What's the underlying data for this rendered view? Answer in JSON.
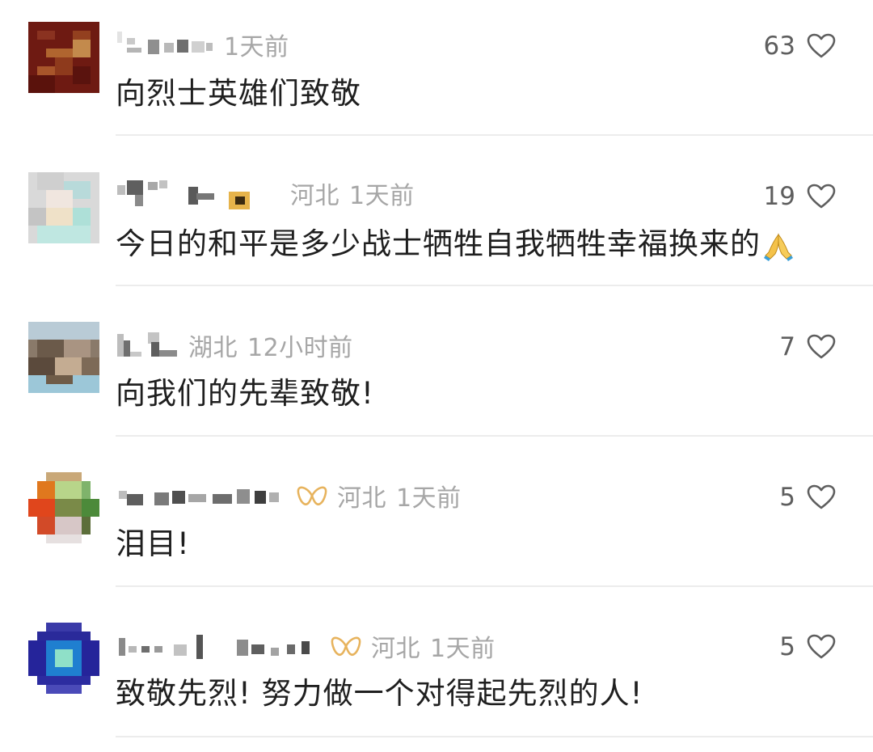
{
  "colors": {
    "meta_gray": "#a6a6a6",
    "text": "#1f1f1f",
    "like_gray": "#5e5e5e",
    "badge_gold": "#e7b35d",
    "divider": "#ececec"
  },
  "comments": [
    {
      "location": "",
      "time": "1天前",
      "text": "向烈士英雄们致敬",
      "likes": "63"
    },
    {
      "location": "河北",
      "time": "1天前",
      "text": "今日的和平是多少战士牺牲自我牺牲幸福换来的",
      "emoji": "folded-hands-icon",
      "likes": "19"
    },
    {
      "location": "湖北",
      "time": "12小时前",
      "text": "向我们的先辈致敬!",
      "likes": "7"
    },
    {
      "location": "河北",
      "time": "1天前",
      "text": "泪目!",
      "likes": "5",
      "badge": "fan-badge-icon"
    },
    {
      "location": "河北",
      "time": "1天前",
      "text": "致敬先烈! 努力做一个对得起先烈的人!",
      "likes": "5",
      "badge": "fan-badge-icon"
    }
  ]
}
